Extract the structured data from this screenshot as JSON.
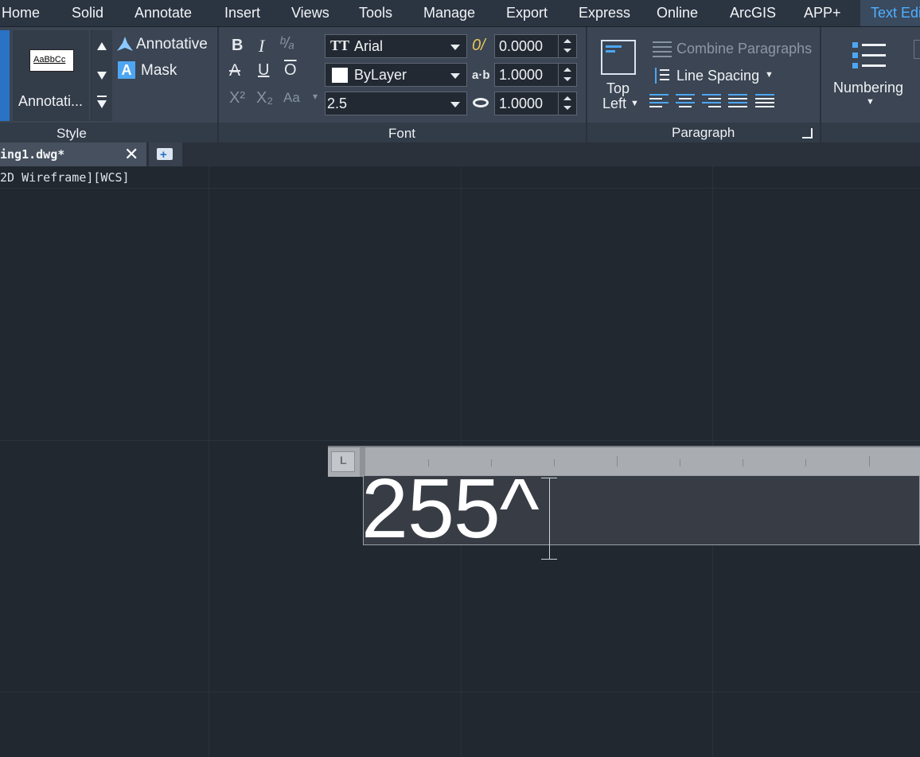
{
  "menubar": {
    "items": [
      "Home",
      "Solid",
      "Annotate",
      "Insert",
      "Views",
      "Tools",
      "Manage",
      "Export",
      "Express",
      "Online",
      "ArcGIS",
      "APP+",
      "Text Edi"
    ]
  },
  "ribbon": {
    "style_panel": {
      "title": "Style",
      "preview_text": "AaBbCc",
      "style_name": "Annotati...",
      "annotative_label": "Annotative",
      "mask_label": "Mask"
    },
    "font_panel": {
      "title": "Font",
      "font_name": "Arial",
      "color_name": "ByLayer",
      "text_height": "2.5",
      "oblique_angle": "0.0000",
      "tracking": "1.0000",
      "width_factor": "1.0000"
    },
    "paragraph_panel": {
      "title": "Paragraph",
      "justify_line1": "Top",
      "justify_line2": "Left",
      "combine_label": "Combine Paragraphs",
      "line_spacing_label": "Line Spacing"
    },
    "numbering_label": "Numbering"
  },
  "document": {
    "tab_label": "ing1.dwg*",
    "view_label": "2D Wireframe][WCS]"
  },
  "editor": {
    "text": "255^"
  },
  "colors": {
    "accent": "#4fb0ff",
    "ribbon": "#3b4553",
    "canvas": "#212830"
  }
}
